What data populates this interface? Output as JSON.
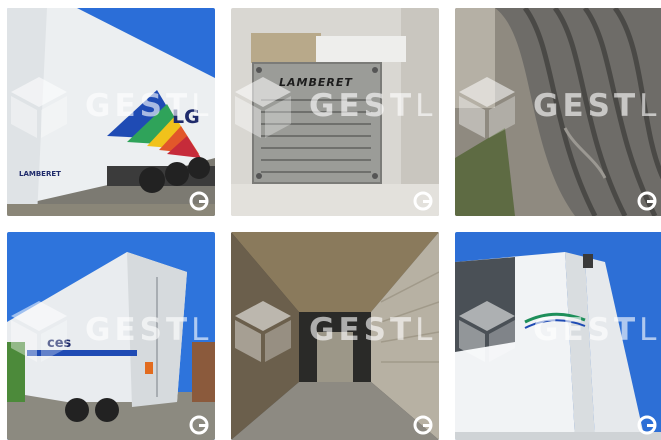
{
  "gallery": {
    "watermark": {
      "bold": "GEST",
      "light": "LEAS"
    },
    "tiles": [
      {
        "name": "trailer-side-view",
        "label_a": "LG",
        "label_b": "LAMBERET"
      },
      {
        "name": "manufacturer-plate",
        "label_a": "LAMBERET",
        "label_b": ""
      },
      {
        "name": "tire-closeup",
        "label_a": "",
        "label_b": ""
      },
      {
        "name": "trailer-rear-three-quarter",
        "label_a": "ces",
        "label_b": ""
      },
      {
        "name": "cargo-interior",
        "label_a": "",
        "label_b": ""
      },
      {
        "name": "refrigeration-unit",
        "label_a": "",
        "label_b": ""
      }
    ]
  },
  "colors": {
    "sky": "#2c6fd6",
    "trailer_white": "#eef0f2",
    "accent_blue": "#1f4bb4"
  }
}
